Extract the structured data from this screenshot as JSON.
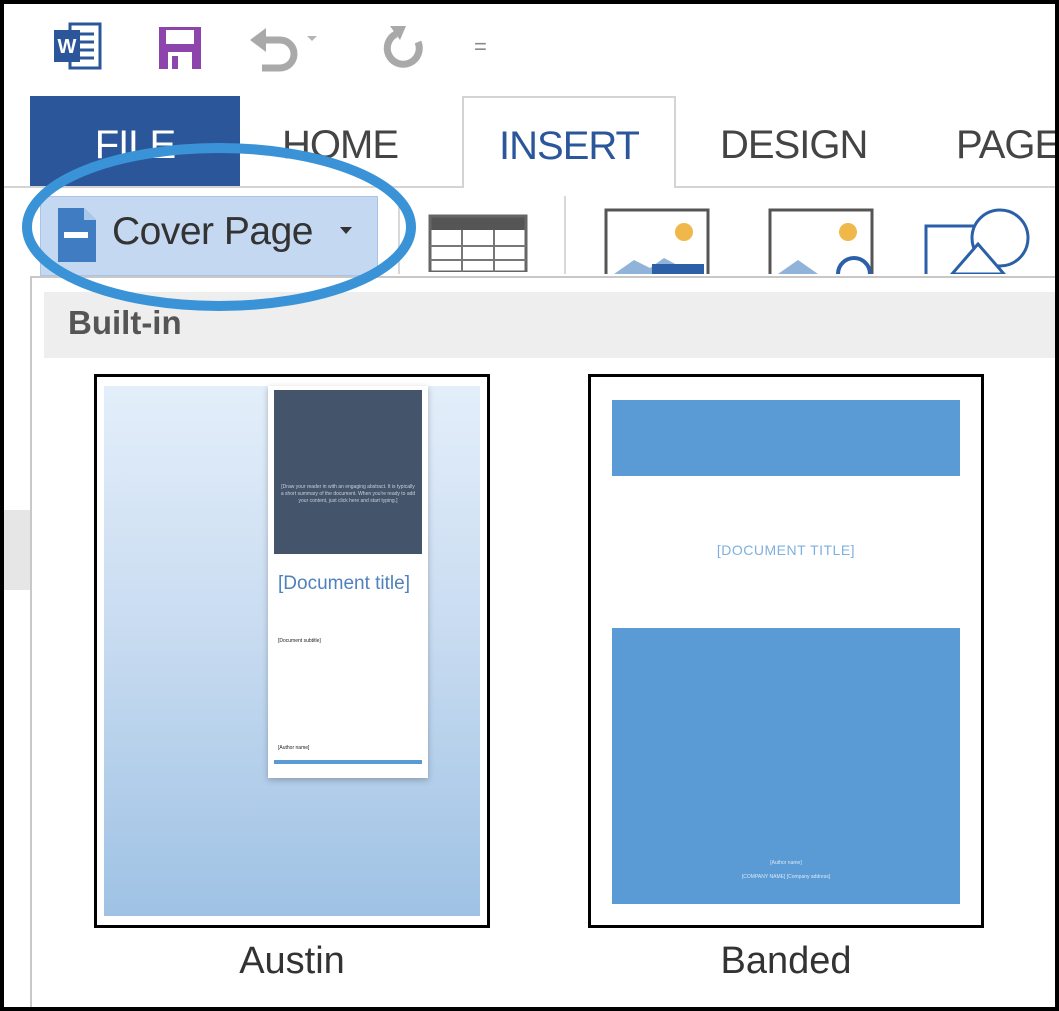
{
  "quick_access": {
    "word_icon": "word-logo-icon",
    "save_icon": "save-icon",
    "undo_icon": "undo-icon",
    "redo_icon": "redo-icon",
    "customize_glyph": "="
  },
  "tabs": [
    {
      "label": "FILE"
    },
    {
      "label": "HOME"
    },
    {
      "label": "INSERT"
    },
    {
      "label": "DESIGN"
    },
    {
      "label": "PAGE"
    }
  ],
  "ribbon": {
    "cover_page_label": "Cover Page",
    "highlight_color": "#3a93d6"
  },
  "gallery": {
    "section_label": "Built-in",
    "items": [
      {
        "name": "Austin",
        "abstract": "[Draw your reader in with an engaging abstract. It is typically a short summary of the document. When you're ready to add your content, just click here and start typing.]",
        "title": "[Document title]",
        "subtitle": "[Document subtitle]",
        "author": "[Author name]"
      },
      {
        "name": "Banded",
        "title": "[DOCUMENT TITLE]",
        "author": "[Author name]",
        "company": "[COMPANY NAME] [Company address]"
      }
    ]
  },
  "colors": {
    "file_tab": "#2b579a",
    "active_tab_text": "#2b579a",
    "cover_button_bg": "#c5d8f1",
    "banded_blue": "#5b9bd5",
    "austin_dark": "#44546a"
  }
}
